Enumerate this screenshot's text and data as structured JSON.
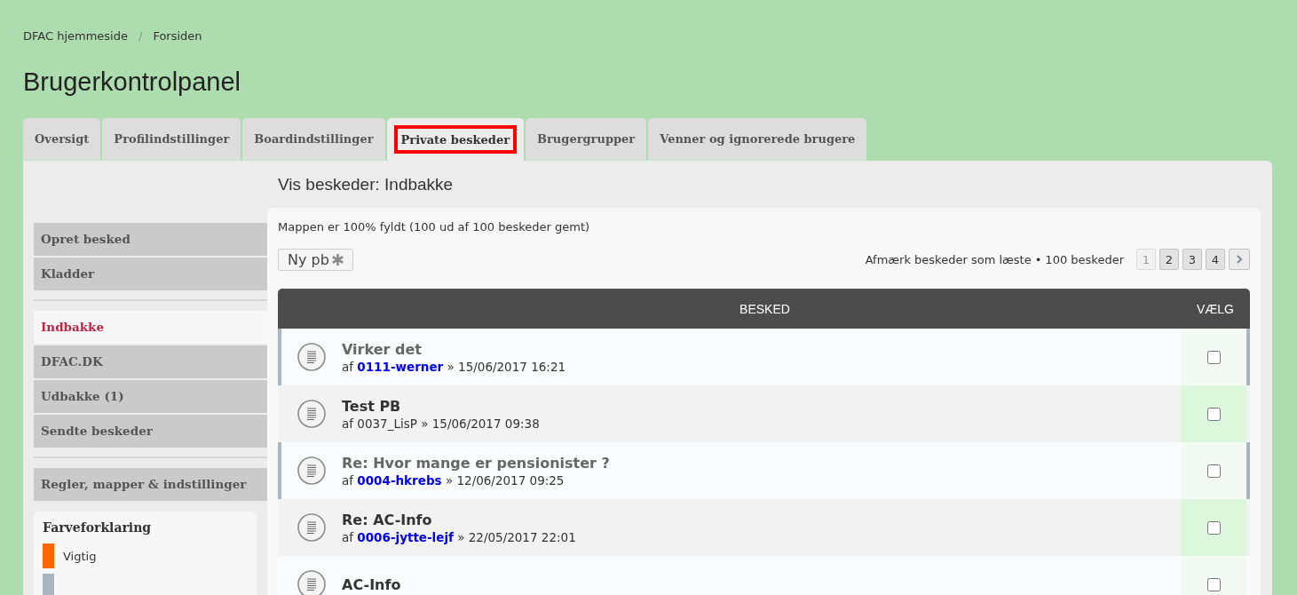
{
  "breadcrumbs": [
    "DFAC hjemmeside",
    "Forsiden"
  ],
  "breadcrumb_separator": "/",
  "page_title": "Brugerkontrolpanel",
  "tabs": [
    {
      "label": "Oversigt",
      "selected": false,
      "highlighted": false
    },
    {
      "label": "Profilindstillinger",
      "selected": false,
      "highlighted": false
    },
    {
      "label": "Boardindstillinger",
      "selected": false,
      "highlighted": false
    },
    {
      "label": "Private beskeder",
      "selected": true,
      "highlighted": true
    },
    {
      "label": "Brugergrupper",
      "selected": false,
      "highlighted": false
    },
    {
      "label": "Venner og ignorerede brugere",
      "selected": false,
      "highlighted": false
    }
  ],
  "sidebar": {
    "groups": [
      [
        {
          "label": "Opret besked",
          "selected": false
        },
        {
          "label": "Kladder",
          "selected": false
        }
      ],
      [
        {
          "label": "Indbakke",
          "selected": true
        },
        {
          "label": "DFAC.DK",
          "selected": false
        },
        {
          "label": "Udbakke (1)",
          "selected": false
        },
        {
          "label": "Sendte beskeder",
          "selected": false
        }
      ],
      [
        {
          "label": "Regler, mapper & indstillinger",
          "selected": false
        }
      ]
    ],
    "legend": {
      "title": "Farveforklaring",
      "items": [
        {
          "label": "Vigtig",
          "color": "#ff6600"
        },
        {
          "color": "#a9b6c0"
        }
      ]
    }
  },
  "heading": "Vis beskeder: Indbakke",
  "folder_status": "Mappen er 100% fyldt (100 ud af 100 beskeder gemt)",
  "new_button": "Ny pb",
  "mark_read_link": "Afmærk beskeder som læste",
  "info_separator": "•",
  "message_count": "100 beskeder",
  "pagination": [
    {
      "label": "1",
      "selected": true
    },
    {
      "label": "2",
      "selected": false
    },
    {
      "label": "3",
      "selected": false
    },
    {
      "label": "4",
      "selected": false
    }
  ],
  "table": {
    "columns": [
      "BESKED",
      "VÆLG"
    ],
    "rows": [
      {
        "title": "Virker det",
        "by": "af",
        "author": "0111-werner",
        "author_link": true,
        "date": "» 15/06/2017 16:21",
        "unread": true,
        "checked": false
      },
      {
        "title": "Test PB",
        "by": "af",
        "author": "0037_LisP",
        "author_link": false,
        "date": "» 15/06/2017 09:38",
        "unread": false,
        "checked": false
      },
      {
        "title": "Re: Hvor mange er pensionister ?",
        "by": "af",
        "author": "0004-hkrebs",
        "author_link": true,
        "date": "» 12/06/2017 09:25",
        "unread": true,
        "checked": false
      },
      {
        "title": "Re: AC-Info",
        "by": "af",
        "author": "0006-jytte-lejf",
        "author_link": true,
        "date": "» 22/05/2017 22:01",
        "unread": false,
        "checked": false
      },
      {
        "title": "AC-Info",
        "unread": false,
        "checked": false
      }
    ]
  }
}
